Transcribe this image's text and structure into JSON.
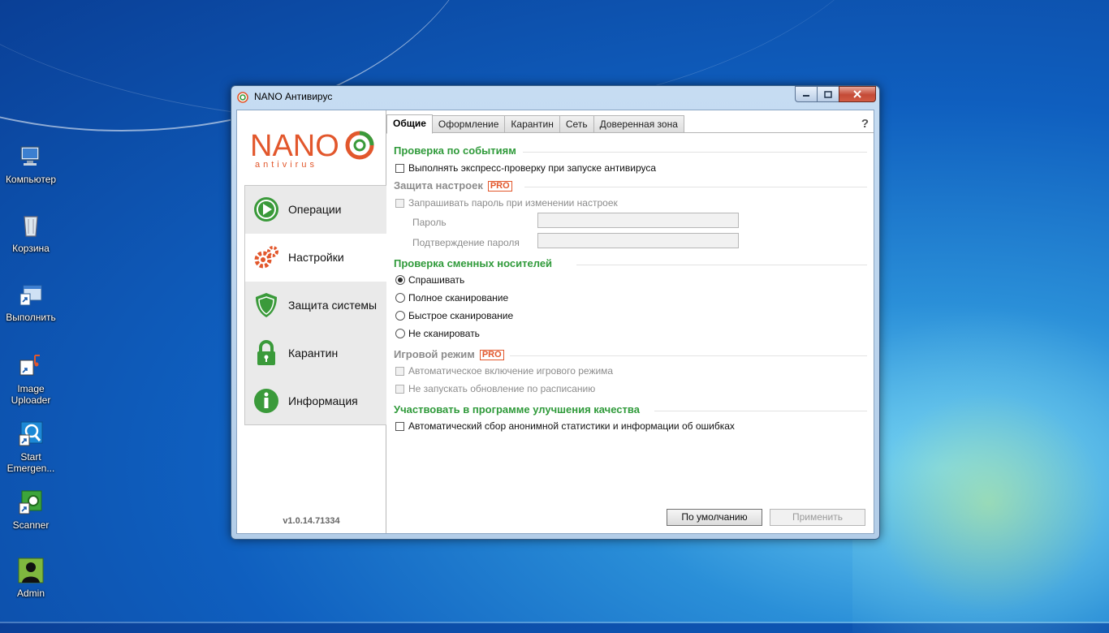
{
  "colors": {
    "accent_green": "#2f9a3a",
    "logo_orange": "#e2572c",
    "disabled_gray": "#8c8c8c"
  },
  "desktop": {
    "icons": [
      {
        "label": "Компьютер",
        "icon": "computer-icon"
      },
      {
        "label": "Корзина",
        "icon": "recycle-bin-icon"
      },
      {
        "label": "Выполнить",
        "icon": "run-icon"
      },
      {
        "label": "Image Uploader",
        "icon": "image-uploader-icon"
      },
      {
        "label": "Start Emergen...",
        "icon": "emergency-icon"
      },
      {
        "label": "Scanner",
        "icon": "scanner-icon"
      },
      {
        "label": "Admin",
        "icon": "user-icon"
      }
    ]
  },
  "window": {
    "title": "NANO Антивирус",
    "version": "v1.0.14.71334",
    "logo": {
      "brand": "NANO",
      "sub": "antivirus"
    }
  },
  "sidebar": {
    "items": [
      {
        "label": "Операции",
        "icon": "play-icon"
      },
      {
        "label": "Настройки",
        "icon": "gears-icon",
        "selected": true
      },
      {
        "label": "Защита системы",
        "icon": "shield-icon"
      },
      {
        "label": "Карантин",
        "icon": "lock-icon"
      },
      {
        "label": "Информация",
        "icon": "info-icon"
      }
    ]
  },
  "tabs": [
    {
      "label": "Общие",
      "active": true
    },
    {
      "label": "Оформление"
    },
    {
      "label": "Карантин"
    },
    {
      "label": "Сеть"
    },
    {
      "label": "Доверенная зона"
    }
  ],
  "help_label": "?",
  "settings": {
    "events": {
      "title": "Проверка по событиям",
      "express_scan": {
        "label": "Выполнять экспресс-проверку при запуске антивируса",
        "checked": false
      }
    },
    "protection": {
      "title": "Защита настроек",
      "pro_badge": "PRO",
      "ask_password": {
        "label": "Запрашивать пароль при изменении настроек",
        "checked": false,
        "disabled": true
      },
      "password_label": "Пароль",
      "confirm_label": "Подтверждение пароля"
    },
    "removable": {
      "title": "Проверка сменных носителей",
      "options": [
        {
          "label": "Спрашивать",
          "selected": true
        },
        {
          "label": "Полное сканирование",
          "selected": false
        },
        {
          "label": "Быстрое сканирование",
          "selected": false
        },
        {
          "label": "Не сканировать",
          "selected": false
        }
      ]
    },
    "game": {
      "title": "Игровой режим",
      "pro_badge": "PRO",
      "auto_game": {
        "label": "Автоматическое включение игрового режима",
        "checked": false,
        "disabled": true
      },
      "no_update": {
        "label": "Не запускать обновление по расписанию",
        "checked": false,
        "disabled": true
      }
    },
    "quality": {
      "title": "Участвовать в программе улучшения качества",
      "stats": {
        "label": "Автоматический сбор анонимной статистики и информации об ошибках",
        "checked": false
      }
    }
  },
  "buttons": {
    "default": "По умолчанию",
    "apply": "Применить"
  }
}
